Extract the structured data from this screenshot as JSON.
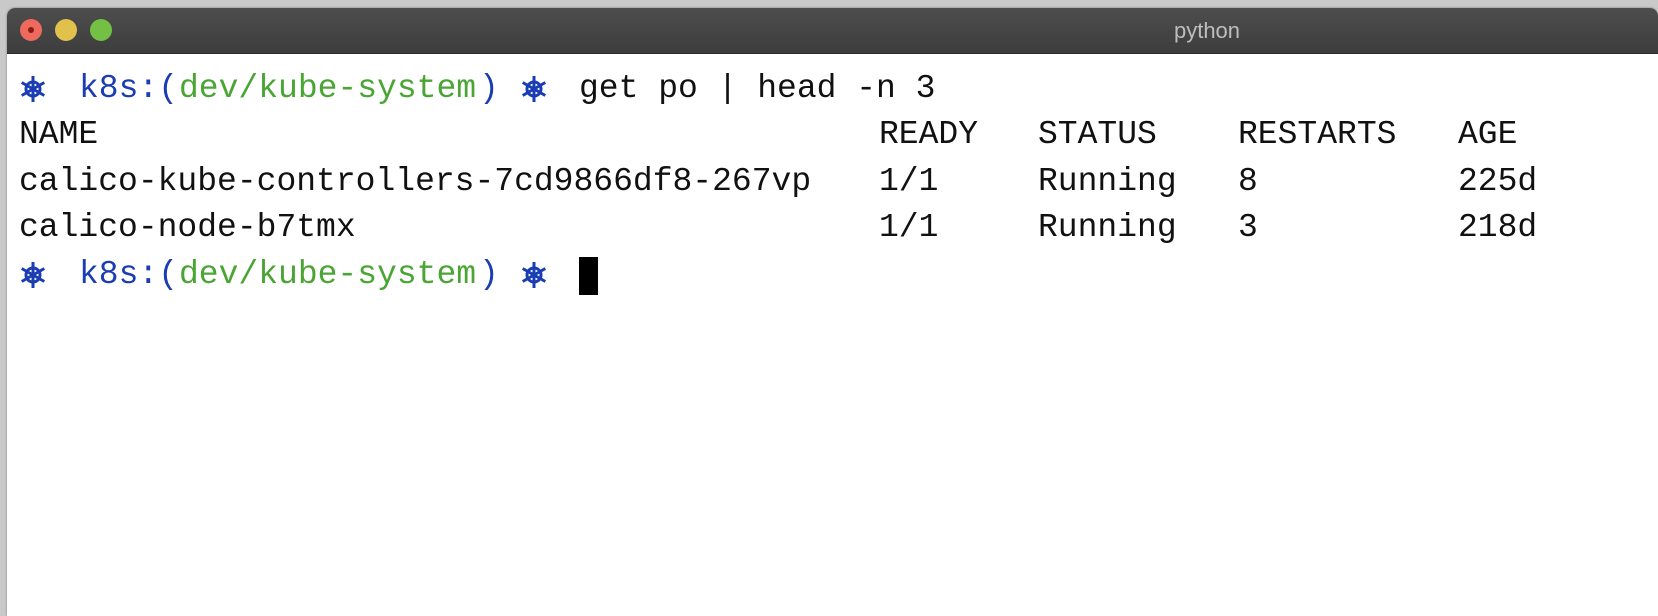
{
  "window": {
    "title": "python"
  },
  "prompt": {
    "prefix": "k8s:(",
    "context": "dev/kube-system",
    "suffix": ")",
    "icon": "helm-wheel-icon",
    "colors": {
      "prompt": "#1b3db3",
      "context": "#4aa534"
    }
  },
  "command": "get po | head -n 3",
  "table": {
    "headers": [
      "NAME",
      "READY",
      "STATUS",
      "RESTARTS",
      "AGE"
    ],
    "rows": [
      [
        "calico-kube-controllers-7cd9866df8-267vp",
        "1/1",
        "Running",
        "8",
        "225d"
      ],
      [
        "calico-node-b7tmx",
        "1/1",
        "Running",
        "3",
        "218d"
      ]
    ]
  }
}
